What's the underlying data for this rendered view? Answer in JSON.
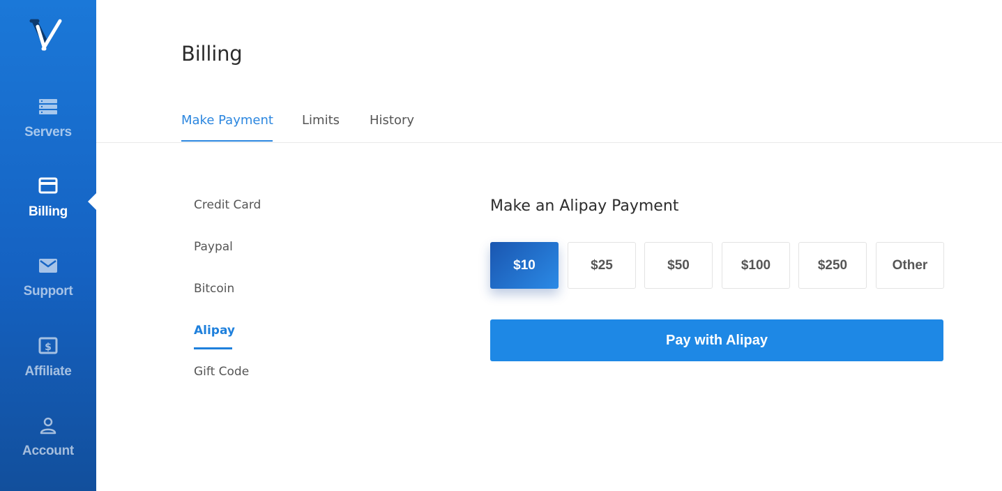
{
  "brand": {
    "logo_icon": "brand-v-logo",
    "colors": {
      "sidebar_top": "#1b78d8",
      "sidebar_bottom": "#124f9c",
      "accent": "#2b86df",
      "pay_button": "#1e88e5"
    }
  },
  "sidebar": {
    "items": [
      {
        "label": "Servers",
        "icon": "server-stack-icon",
        "active": false
      },
      {
        "label": "Billing",
        "icon": "credit-card-icon",
        "active": true
      },
      {
        "label": "Support",
        "icon": "envelope-icon",
        "active": false
      },
      {
        "label": "Affiliate",
        "icon": "dollar-bill-icon",
        "active": false
      },
      {
        "label": "Account",
        "icon": "user-icon",
        "active": false
      }
    ]
  },
  "page": {
    "title": "Billing"
  },
  "tabs": [
    {
      "label": "Make Payment",
      "active": true
    },
    {
      "label": "Limits",
      "active": false
    },
    {
      "label": "History",
      "active": false
    }
  ],
  "payment_methods": [
    {
      "label": "Credit Card",
      "active": false
    },
    {
      "label": "Paypal",
      "active": false
    },
    {
      "label": "Bitcoin",
      "active": false
    },
    {
      "label": "Alipay",
      "active": true
    },
    {
      "label": "Gift Code",
      "active": false
    }
  ],
  "payment_form": {
    "title": "Make an Alipay Payment",
    "amounts": [
      {
        "label": "$10",
        "selected": true
      },
      {
        "label": "$25",
        "selected": false
      },
      {
        "label": "$50",
        "selected": false
      },
      {
        "label": "$100",
        "selected": false
      },
      {
        "label": "$250",
        "selected": false
      },
      {
        "label": "Other",
        "selected": false
      }
    ],
    "submit_label": "Pay with Alipay"
  }
}
